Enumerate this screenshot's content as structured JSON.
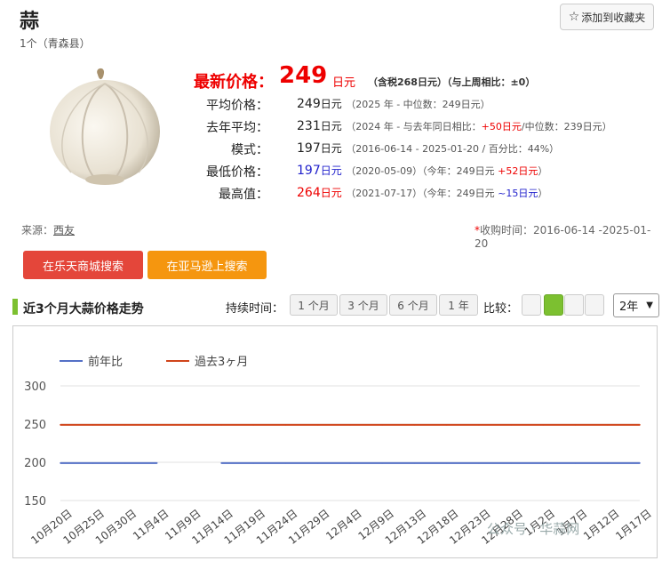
{
  "header": {
    "title": "蒜",
    "subtitle": "1个（青森县）",
    "favorite_label": "添加到收藏夹",
    "favorite_icon": "star-outline-icon"
  },
  "product_image": {
    "icon": "garlic-bulb"
  },
  "price": {
    "latest_label": "最新价格：",
    "latest_value": "249",
    "latest_unit": "日元",
    "latest_tax": "（含税268日元）（与上周相比：±0）",
    "rows": [
      {
        "label": "平均价格：",
        "value": "249",
        "unit": "日元",
        "note_a": "（2025 年 - 中位数：249日元）",
        "note_diff": "",
        "note_b": ""
      },
      {
        "label": "去年平均：",
        "value": "231",
        "unit": "日元",
        "note_a": "（2024 年 - 与去年同日相比：",
        "note_diff": "+50日元",
        "note_b": "/中位数：239日元）"
      },
      {
        "label": "模式：",
        "value": "197",
        "unit": "日元",
        "note_a": "（2016-06-14 - 2025-01-20 / 百分比：44%）",
        "note_diff": "",
        "note_b": ""
      },
      {
        "label": "最低价格：",
        "value": "197",
        "unit": "日元",
        "note_a": "（2020-05-09）（今年：249日元 ",
        "note_diff": "+52日元",
        "note_b": "）"
      },
      {
        "label": "最高值：",
        "value": "264",
        "unit": "日元",
        "note_a": "（2021-07-17）（今年：249日元 ",
        "note_diff": "~15日元",
        "note_b": "）"
      }
    ]
  },
  "source": {
    "label": "来源：",
    "link": "西友"
  },
  "period": {
    "star": "*",
    "text": "收购时间：2016-06-14 -2025-01-20"
  },
  "buttons": {
    "rakuten": "在乐天商城搜索",
    "amazon": "在亚马逊上搜索"
  },
  "trend": {
    "title": "近3个月大蒜价格走势",
    "duration_label": "持续时间：",
    "durations": [
      "1 个月",
      "3 个月",
      "6 个月",
      "1 年"
    ],
    "compare_label": "比较：",
    "year_selected": "2年"
  },
  "colors": {
    "red": "#e00000",
    "blue": "#2222cc",
    "accent_green": "#7cc030",
    "series_prev_year": "#5470c6",
    "series_past3m": "#d0451b"
  },
  "watermark": "公众号 · 华蒜网",
  "chart_data": {
    "type": "line",
    "title": "",
    "xlabel": "",
    "ylabel": "",
    "ylim": [
      150,
      300
    ],
    "yticks": [
      150,
      200,
      250,
      300
    ],
    "grid": true,
    "legend": "top-left",
    "categories": [
      "10月20日",
      "10月25日",
      "10月30日",
      "11月4日",
      "11月9日",
      "11月14日",
      "11月19日",
      "11月24日",
      "11月29日",
      "12月4日",
      "12月9日",
      "12月13日",
      "12月18日",
      "12月23日",
      "12月28日",
      "1月2日",
      "1月7日",
      "1月12日",
      "1月17日"
    ],
    "series": [
      {
        "name": "前年比",
        "color": "#5470c6",
        "values": [
          199,
          199,
          199,
          199,
          null,
          199,
          199,
          199,
          199,
          199,
          199,
          199,
          199,
          199,
          199,
          199,
          199,
          199,
          199
        ]
      },
      {
        "name": "過去3ヶ月",
        "color": "#d0451b",
        "values": [
          249,
          249,
          249,
          249,
          249,
          249,
          249,
          249,
          249,
          249,
          249,
          249,
          249,
          249,
          249,
          249,
          249,
          249,
          249
        ]
      }
    ]
  }
}
